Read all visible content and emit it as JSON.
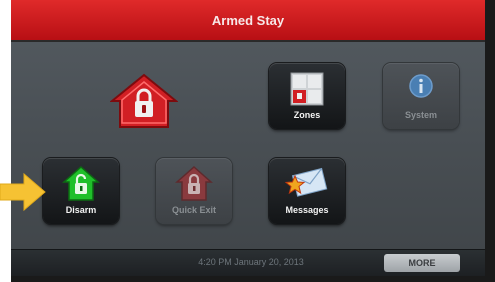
{
  "header": {
    "title": "Armed Stay"
  },
  "tiles": {
    "zones": {
      "label": "Zones",
      "icon": "zones-icon"
    },
    "system": {
      "label": "System",
      "icon": "info-icon",
      "enabled": false
    },
    "disarm": {
      "label": "Disarm",
      "icon": "house-lock-icon"
    },
    "quick_exit": {
      "label": "Quick Exit",
      "icon": "house-lock-icon",
      "enabled": false
    },
    "messages": {
      "label": "Messages",
      "icon": "envelope-icon"
    }
  },
  "status_icon": "armed-house-lock-icon",
  "footer": {
    "timestamp": "4:20 PM January 20, 2013",
    "more_label": "MORE"
  },
  "colors": {
    "header": "#c8141a",
    "armed": "#d11f24",
    "disarm": "#1fbf2a",
    "pointer_arrow": "#f6c233"
  }
}
